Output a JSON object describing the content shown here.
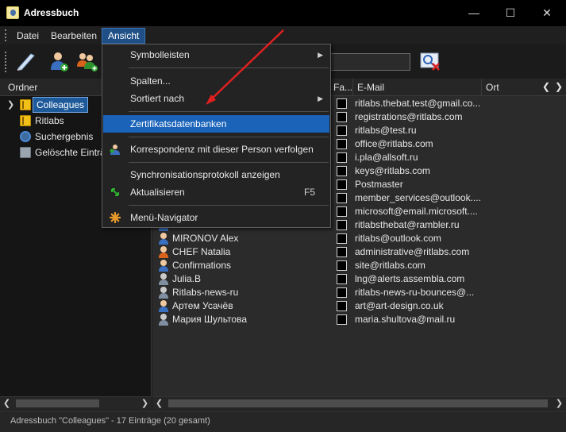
{
  "window": {
    "title": "Adressbuch",
    "minimize": "—",
    "maximize": "☐",
    "close": "✕"
  },
  "menubar": {
    "items": [
      "Datei",
      "Bearbeiten",
      "Ansicht"
    ]
  },
  "folders": {
    "header": "Ordner",
    "items": [
      {
        "label": "Colleagues",
        "icon": "address-book-icon",
        "selected": true
      },
      {
        "label": "Ritlabs",
        "icon": "address-book-icon"
      },
      {
        "label": "Suchergebnis",
        "icon": "search-results-icon"
      },
      {
        "label": "Gelöschte Einträ",
        "icon": "trash-icon"
      }
    ]
  },
  "list": {
    "columns": {
      "fav": "Fa...",
      "email": "E-Mail",
      "ort": "Ort"
    },
    "rows": [
      {
        "name": "",
        "email": "ritlabs.thebat.test@gmail.co...",
        "avatar": "blue"
      },
      {
        "name": "",
        "email": "registrations@ritlabs.com",
        "avatar": "blue"
      },
      {
        "name": "",
        "email": "ritlabs@test.ru",
        "avatar": "blue"
      },
      {
        "name": "",
        "email": "office@ritlabs.com",
        "avatar": "blue"
      },
      {
        "name": "",
        "email": "i.pla@allsoft.ru",
        "avatar": "blue"
      },
      {
        "name": "",
        "email": "keys@ritlabs.com",
        "avatar": "blue"
      },
      {
        "name": "",
        "email": "Postmaster",
        "avatar": "blue"
      },
      {
        "name": "",
        "email": "member_services@outlook....",
        "avatar": "blue"
      },
      {
        "name": "",
        "email": "microsoft@email.microsoft....",
        "avatar": "blue"
      },
      {
        "name": "",
        "email": "ritlabsthebat@rambler.ru",
        "avatar": "blue"
      },
      {
        "name": "MIRONOV Alex",
        "email": "ritlabs@outlook.com",
        "avatar": "blue"
      },
      {
        "name": "CHEF Natalia",
        "email": "administrative@ritlabs.com",
        "avatar": "orange"
      },
      {
        "name": "Confirmations",
        "email": "site@ritlabs.com",
        "avatar": "blue"
      },
      {
        "name": "Julia.B",
        "email": "lng@alerts.assembla.com",
        "avatar": "gray"
      },
      {
        "name": "Ritlabs-news-ru",
        "email": "ritlabs-news-ru-bounces@...",
        "avatar": "gray"
      },
      {
        "name": "Артем Усачёв",
        "email": "art@art-design.co.uk",
        "avatar": "blue"
      },
      {
        "name": "Мария Шультова",
        "email": "maria.shultova@mail.ru",
        "avatar": "gray"
      }
    ]
  },
  "dropdown": {
    "items": [
      {
        "label": "Symbolleisten",
        "submenu": true
      },
      {
        "separator": true
      },
      {
        "label": "Spalten..."
      },
      {
        "label": "Sortiert nach",
        "submenu": true
      },
      {
        "separator": true
      },
      {
        "label": "Zertifikatsdatenbanken",
        "highlighted": true
      },
      {
        "separator": true
      },
      {
        "label": "Korrespondenz mit dieser Person verfolgen",
        "icon": "person-follow-icon"
      },
      {
        "separator": true
      },
      {
        "label": "Synchronisationsprotokoll anzeigen"
      },
      {
        "label": "Aktualisieren",
        "shortcut": "F5",
        "icon": "refresh-icon"
      },
      {
        "separator": true
      },
      {
        "label": "Menü-Navigator",
        "icon": "menu-navigator-icon"
      }
    ]
  },
  "statusbar": {
    "text": "Adressbuch \"Colleagues\" - 17 Einträge (20 gesamt)"
  },
  "colors": {
    "highlight": "#1a63b8",
    "selection": "#1e5a9a",
    "arrow": "#e02020"
  }
}
